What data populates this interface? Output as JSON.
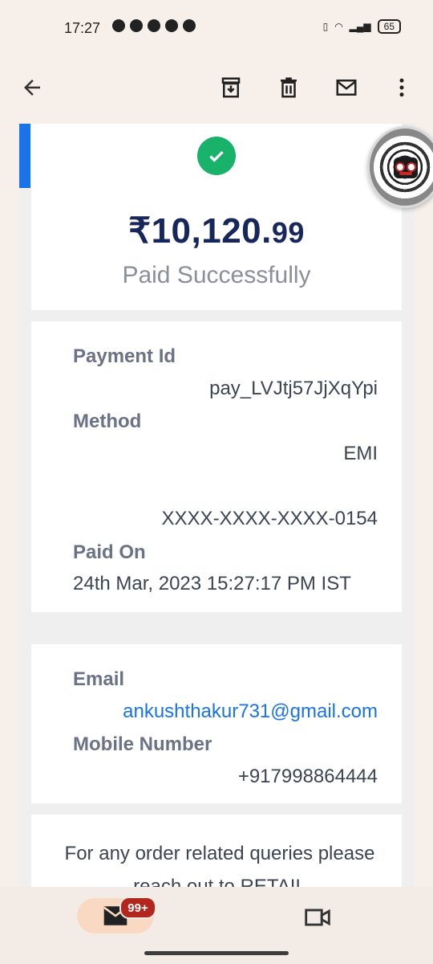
{
  "status_bar": {
    "time": "17:27",
    "battery": "65"
  },
  "toolbar": {
    "back": "back-arrow-icon",
    "archive": "archive-icon",
    "delete": "delete-icon",
    "mark_unread": "mail-icon",
    "more": "more-vert-icon"
  },
  "receipt": {
    "amount_main": "₹10,120.",
    "amount_decimals": "99",
    "status": "Paid Successfully",
    "payment_id_label": "Payment Id",
    "payment_id": "pay_LVJtj57JjXqYpi",
    "method_label": "Method",
    "method": "EMI",
    "card_number": "XXXX-XXXX-XXXX-0154",
    "paid_on_label": "Paid On",
    "paid_on": "24th Mar, 2023 15:27:17 PM IST",
    "email_label": "Email",
    "email": "ankushthakur731@gmail.com",
    "mobile_label": "Mobile Number",
    "mobile": "+917998864444",
    "query_text": "For any order related queries please reach out to RETAIL"
  },
  "bottom_nav": {
    "mail_badge": "99+"
  },
  "colors": {
    "accent": "#1a73e8",
    "success": "#18b26b",
    "amount": "#17275c",
    "badge": "#b3261e"
  }
}
